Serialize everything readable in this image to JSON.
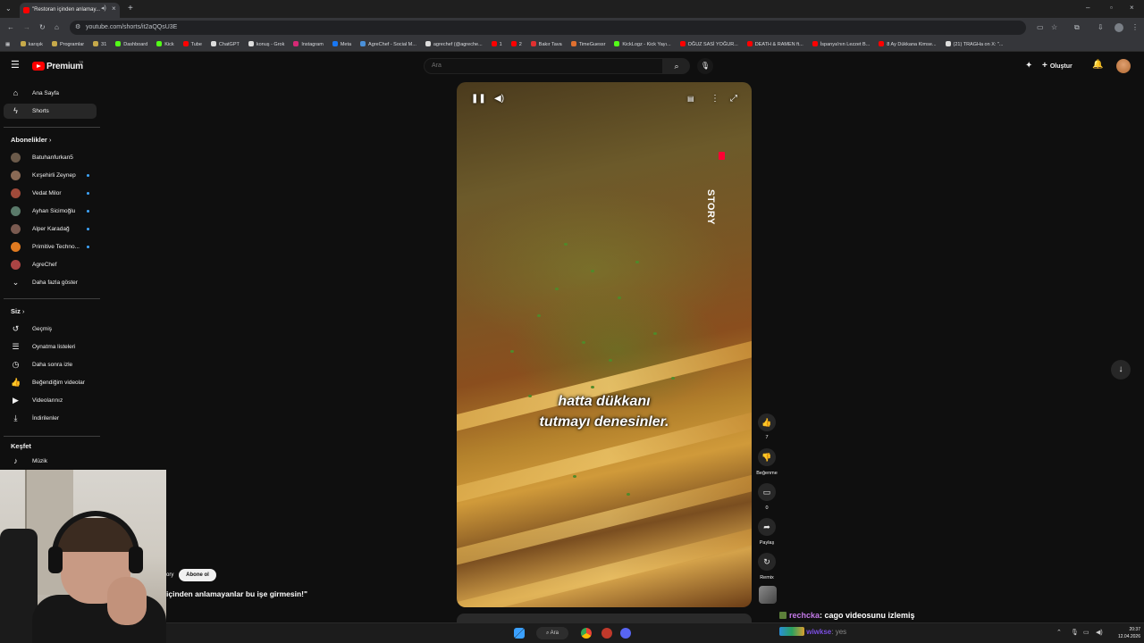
{
  "browser": {
    "tab_title": "\"Restoran içinden anlamay...",
    "url": "youtube.com/shorts/it2aQQsU3E",
    "bookmarks": [
      {
        "label": "karışık",
        "color": "#c6a94a"
      },
      {
        "label": "Programlar",
        "color": "#c6a94a"
      },
      {
        "label": "31",
        "color": "#c6a94a"
      },
      {
        "label": "Dashboard",
        "color": "#53fc18"
      },
      {
        "label": "Kick",
        "color": "#53fc18"
      },
      {
        "label": "Tube",
        "color": "#ff0000"
      },
      {
        "label": "ChatGPT",
        "color": "#dddddd"
      },
      {
        "label": "konuş - Grok",
        "color": "#dddddd"
      },
      {
        "label": "Instagram",
        "color": "#d62976"
      },
      {
        "label": "Meta",
        "color": "#1877f2"
      },
      {
        "label": "AgreChef - Social M...",
        "color": "#4a90d9"
      },
      {
        "label": "agrechef (@agreche...",
        "color": "#dddddd"
      },
      {
        "label": "1",
        "color": "#ff0000"
      },
      {
        "label": "2",
        "color": "#ff0000"
      },
      {
        "label": "Bakır Tava",
        "color": "#e03030"
      },
      {
        "label": "TimeGuessr",
        "color": "#e07030"
      },
      {
        "label": "KickLogz - Kick Yayı...",
        "color": "#53fc18"
      },
      {
        "label": "OĞUZ SASİ YOĞUR...",
        "color": "#ff0000"
      },
      {
        "label": "DEATH & RAMEN ft...",
        "color": "#ff0000"
      },
      {
        "label": "İspanya'nın Lezzet B...",
        "color": "#ff0000"
      },
      {
        "label": "8 Ay Dükkana Kimse...",
        "color": "#ff0000"
      },
      {
        "label": "(21) TRAGHa on X: \"...",
        "color": "#dddddd"
      }
    ]
  },
  "youtube": {
    "logo_text": "Premium",
    "logo_sup": "TR",
    "search_placeholder": "Ara",
    "create_label": "Oluştur",
    "sidebar": {
      "home": "Ana Sayfa",
      "shorts": "Shorts",
      "subscriptions_header": "Abonelikler",
      "subscriptions": [
        {
          "name": "Batuhanfurkan5",
          "color": "#6b5a4a",
          "new": false
        },
        {
          "name": "Kırşehirli Zeynep",
          "color": "#8a6a55",
          "new": true
        },
        {
          "name": "Vedat Milor",
          "color": "#a04a3a",
          "new": true
        },
        {
          "name": "Ayhan Sicimoğlu",
          "color": "#5a7a6a",
          "new": true
        },
        {
          "name": "Alper Karadağ",
          "color": "#7a5a50",
          "new": true
        },
        {
          "name": "Primitive Techno...",
          "color": "#e07a20",
          "new": true
        },
        {
          "name": "AgreChef",
          "color": "#aa4444",
          "new": false
        }
      ],
      "show_more": "Daha fazla göster",
      "you_header": "Siz",
      "you_items": [
        "Geçmiş",
        "Oynatma listeleri",
        "Daha sonra izle",
        "Beğendiğim videolar",
        "Videolarınız",
        "İndirilenler"
      ],
      "explore_header": "Keşfet",
      "explore_items": [
        "Müzik"
      ]
    },
    "short": {
      "caption_line1": "hatta dükkanı",
      "caption_line2": "tutmayı denesinler.",
      "brand_watermark": "STORY",
      "like_count": "7",
      "dislike_label": "Beğenme",
      "comment_count": "0",
      "share_label": "Paylaş",
      "remix_label": "Remix",
      "channel_suffix": "ory",
      "subscribe_label": "Abone ol",
      "title": "içinden anlamayanlar bu işe girmesin!\""
    }
  },
  "stream": {
    "chat_user": "rechcka",
    "chat_message": ": cago videosunu izlemiş",
    "chat_user_color": "#c47ae8",
    "chat2_user": "wiwkse",
    "chat2_message": ": yes"
  },
  "taskbar": {
    "search_label": "Ara",
    "time": "20:37",
    "date": "12.04.2026"
  }
}
